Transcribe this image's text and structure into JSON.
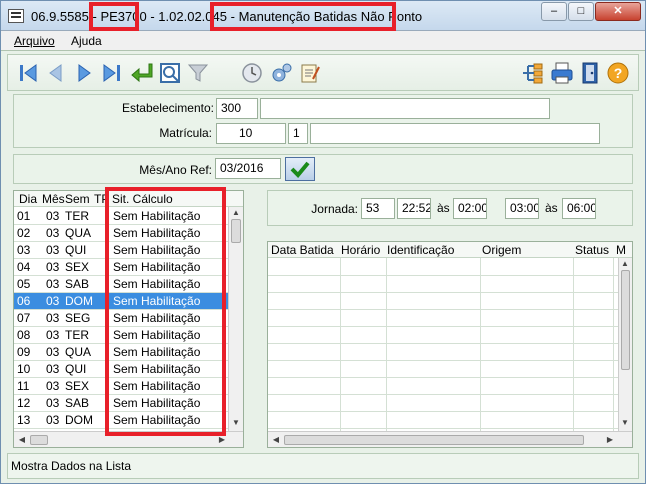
{
  "window": {
    "title_code": "06.9.5585",
    "title_sep1": "-",
    "program": "PE3700",
    "title_sep2": "-",
    "version": "1.02.02.045",
    "title_sep3": "-",
    "title_name": "Manutenção Batidas Não Ponto"
  },
  "menu": {
    "file": "Arquivo",
    "help": "Ajuda"
  },
  "toolbar": {
    "icons": [
      "first-icon",
      "prev-icon",
      "next-icon",
      "last-icon",
      "goto-icon",
      "zoom-icon",
      "filter-icon",
      "clock-icon",
      "gears-icon",
      "notes-icon",
      "tree-icon",
      "print-icon",
      "exit-icon",
      "help-icon"
    ]
  },
  "form": {
    "estab_label": "Estabelecimento:",
    "estab_value": "300",
    "estab_desc": "",
    "matricula_label": "Matrícula:",
    "matricula_value": "10",
    "matricula_digit": "1",
    "matricula_name": "",
    "mesano_label": "Mês/Ano Ref:",
    "mesano_value": "03/2016"
  },
  "days_grid": {
    "headers": {
      "dia": "Dia",
      "mes": "Mês",
      "sem": "Sem",
      "tp": "TP",
      "sit": "Sit. Cálculo"
    },
    "rows": [
      {
        "dia": "01",
        "mes": "03",
        "sem": "TER",
        "sit": "Sem Habilitação"
      },
      {
        "dia": "02",
        "mes": "03",
        "sem": "QUA",
        "sit": "Sem Habilitação"
      },
      {
        "dia": "03",
        "mes": "03",
        "sem": "QUI",
        "sit": "Sem Habilitação"
      },
      {
        "dia": "04",
        "mes": "03",
        "sem": "SEX",
        "sit": "Sem Habilitação"
      },
      {
        "dia": "05",
        "mes": "03",
        "sem": "SAB",
        "sit": "Sem Habilitação"
      },
      {
        "dia": "06",
        "mes": "03",
        "sem": "DOM",
        "sit": "Sem Habilitação"
      },
      {
        "dia": "07",
        "mes": "03",
        "sem": "SEG",
        "sit": "Sem Habilitação"
      },
      {
        "dia": "08",
        "mes": "03",
        "sem": "TER",
        "sit": "Sem Habilitação"
      },
      {
        "dia": "09",
        "mes": "03",
        "sem": "QUA",
        "sit": "Sem Habilitação"
      },
      {
        "dia": "10",
        "mes": "03",
        "sem": "QUI",
        "sit": "Sem Habilitação"
      },
      {
        "dia": "11",
        "mes": "03",
        "sem": "SEX",
        "sit": "Sem Habilitação"
      },
      {
        "dia": "12",
        "mes": "03",
        "sem": "SAB",
        "sit": "Sem Habilitação"
      },
      {
        "dia": "13",
        "mes": "03",
        "sem": "DOM",
        "sit": "Sem Habilitação"
      }
    ],
    "selected_day": "06"
  },
  "jornada": {
    "label": "Jornada:",
    "code": "53",
    "t1": "22:52",
    "as1": "às",
    "t2": "02:00",
    "t3": "03:00",
    "as2": "às",
    "t4": "06:00"
  },
  "batidas_grid": {
    "headers": {
      "data": "Data Batida",
      "hora": "Horário",
      "ident": "Identificação",
      "origem": "Origem",
      "status": "Status",
      "m": "M"
    }
  },
  "status_text": "Mostra Dados na Lista",
  "colors": {
    "highlight": "#e8202a",
    "selection": "#3b8de0"
  }
}
